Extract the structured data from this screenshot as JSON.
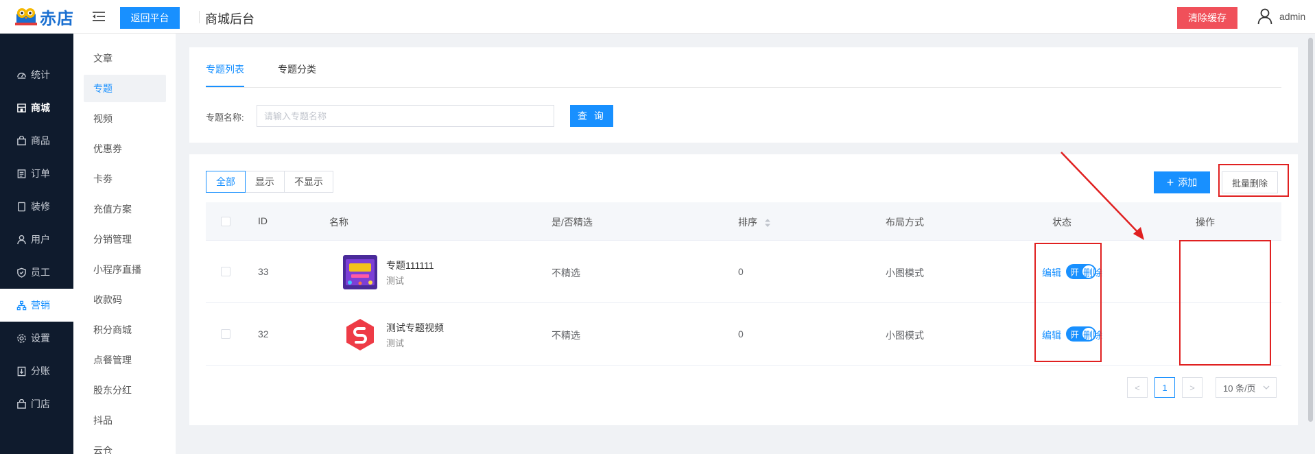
{
  "header": {
    "logo_text": "赤店",
    "back_button": "返回平台",
    "title": "商城后台",
    "clear_cache_button": "清除缓存",
    "user_name": "admin"
  },
  "sidebar_primary": [
    {
      "label": "统计",
      "icon": "dashboard-icon"
    },
    {
      "label": "商城",
      "icon": "store-icon"
    },
    {
      "label": "商品",
      "icon": "bag-icon"
    },
    {
      "label": "订单",
      "icon": "order-icon"
    },
    {
      "label": "装修",
      "icon": "decor-icon"
    },
    {
      "label": "用户",
      "icon": "user-icon"
    },
    {
      "label": "员工",
      "icon": "shield-icon"
    },
    {
      "label": "营销",
      "icon": "sitemap-icon"
    },
    {
      "label": "设置",
      "icon": "gear-icon"
    },
    {
      "label": "分账",
      "icon": "split-icon"
    },
    {
      "label": "门店",
      "icon": "shop-icon"
    }
  ],
  "sidebar_secondary": [
    "文章",
    "专题",
    "视频",
    "优惠券",
    "卡劵",
    "充值方案",
    "分销管理",
    "小程序直播",
    "收款码",
    "积分商城",
    "点餐管理",
    "股东分红",
    "抖品",
    "云仓"
  ],
  "tabs": [
    "专题列表",
    "专题分类"
  ],
  "search": {
    "label": "专题名称:",
    "placeholder": "请输入专题名称",
    "button": "查 询"
  },
  "filters": [
    "全部",
    "显示",
    "不显示"
  ],
  "toolbar": {
    "add_button": "添加",
    "batch_delete_button": "批量删除"
  },
  "table": {
    "columns": [
      "ID",
      "名称",
      "是/否精选",
      "排序",
      "布局方式",
      "状态",
      "操作"
    ],
    "rows": [
      {
        "id": "33",
        "name": "专题111111",
        "sub": "测试",
        "featured": "不精选",
        "sort": "0",
        "layout": "小图模式",
        "status": "开",
        "edit": "编辑",
        "delete": "删除"
      },
      {
        "id": "32",
        "name": "测试专题视频",
        "sub": "测试",
        "featured": "不精选",
        "sort": "0",
        "layout": "小图模式",
        "status": "开",
        "edit": "编辑",
        "delete": "删除"
      }
    ]
  },
  "pagination": {
    "current_page": "1",
    "page_size": "10 条/页",
    "prev": "<",
    "next": ">"
  },
  "colors": {
    "primary": "#1890ff",
    "danger": "#f0505a",
    "sidebar_bg": "#0f1b2d",
    "annotation": "#e02020"
  }
}
